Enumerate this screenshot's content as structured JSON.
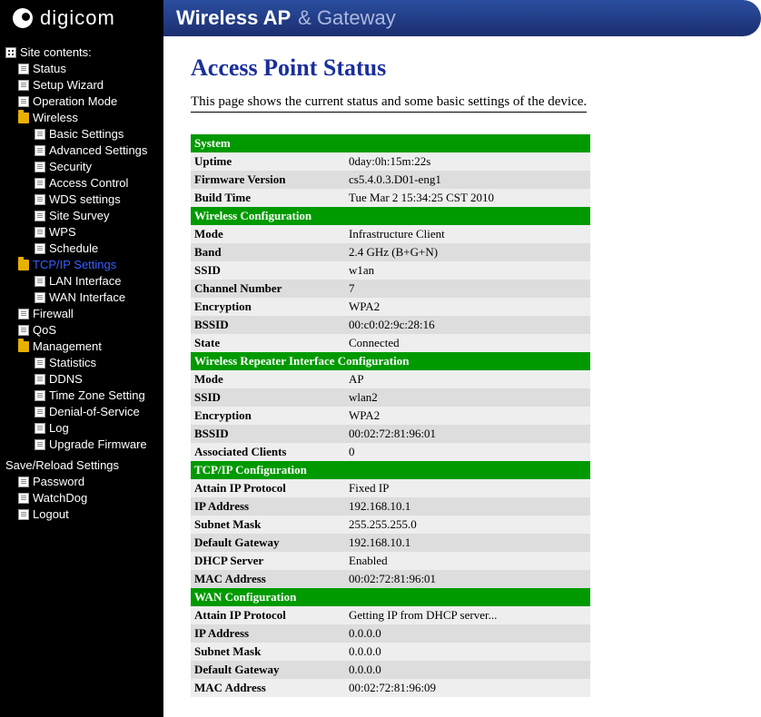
{
  "header": {
    "brand": "digicom",
    "title_strong": "Wireless AP",
    "title_sub": "& Gateway"
  },
  "sidebar": {
    "root_label": "Site contents:",
    "items": [
      {
        "label": "Status",
        "level": 1,
        "icon": "page",
        "selected": false
      },
      {
        "label": "Setup Wizard",
        "level": 1,
        "icon": "page",
        "selected": false
      },
      {
        "label": "Operation Mode",
        "level": 1,
        "icon": "page",
        "selected": false
      },
      {
        "label": "Wireless",
        "level": 1,
        "icon": "folder",
        "selected": false
      },
      {
        "label": "Basic Settings",
        "level": 2,
        "icon": "page",
        "selected": false
      },
      {
        "label": "Advanced Settings",
        "level": 2,
        "icon": "page",
        "selected": false
      },
      {
        "label": "Security",
        "level": 2,
        "icon": "page",
        "selected": false
      },
      {
        "label": "Access Control",
        "level": 2,
        "icon": "page",
        "selected": false
      },
      {
        "label": "WDS settings",
        "level": 2,
        "icon": "page",
        "selected": false
      },
      {
        "label": "Site Survey",
        "level": 2,
        "icon": "page",
        "selected": false
      },
      {
        "label": "WPS",
        "level": 2,
        "icon": "page",
        "selected": false
      },
      {
        "label": "Schedule",
        "level": 2,
        "icon": "page",
        "selected": false
      },
      {
        "label": "TCP/IP Settings",
        "level": 1,
        "icon": "folder",
        "selected": true
      },
      {
        "label": "LAN Interface",
        "level": 2,
        "icon": "page",
        "selected": false
      },
      {
        "label": "WAN Interface",
        "level": 2,
        "icon": "page",
        "selected": false
      },
      {
        "label": "Firewall",
        "level": 1,
        "icon": "page",
        "selected": false
      },
      {
        "label": "QoS",
        "level": 1,
        "icon": "page",
        "selected": false
      },
      {
        "label": "Management",
        "level": 1,
        "icon": "folder",
        "selected": false
      },
      {
        "label": "Statistics",
        "level": 2,
        "icon": "page",
        "selected": false
      },
      {
        "label": "DDNS",
        "level": 2,
        "icon": "page",
        "selected": false
      },
      {
        "label": "Time Zone Setting",
        "level": 2,
        "icon": "page",
        "selected": false
      },
      {
        "label": "Denial-of-Service",
        "level": 2,
        "icon": "page",
        "selected": false
      },
      {
        "label": "Log",
        "level": 2,
        "icon": "page",
        "selected": false
      },
      {
        "label": "Upgrade Firmware",
        "level": 2,
        "icon": "page",
        "selected": false
      }
    ],
    "root2_label": "Save/Reload Settings",
    "items2": [
      {
        "label": "Password",
        "level": 1,
        "icon": "page",
        "selected": false
      },
      {
        "label": "WatchDog",
        "level": 1,
        "icon": "page",
        "selected": false
      },
      {
        "label": "Logout",
        "level": 1,
        "icon": "page",
        "selected": false
      }
    ]
  },
  "page": {
    "title": "Access Point Status",
    "description": "This page shows the current status and some basic settings of the device.",
    "sections": [
      {
        "header": "System",
        "rows": [
          {
            "key": "Uptime",
            "value": "0day:0h:15m:22s"
          },
          {
            "key": "Firmware Version",
            "value": "cs5.4.0.3.D01-eng1"
          },
          {
            "key": "Build Time",
            "value": "Tue Mar 2 15:34:25 CST 2010"
          }
        ]
      },
      {
        "header": "Wireless Configuration",
        "rows": [
          {
            "key": "Mode",
            "value": "Infrastructure Client"
          },
          {
            "key": "Band",
            "value": "2.4 GHz (B+G+N)"
          },
          {
            "key": "SSID",
            "value": "w1an"
          },
          {
            "key": "Channel Number",
            "value": "7"
          },
          {
            "key": "Encryption",
            "value": "WPA2"
          },
          {
            "key": "BSSID",
            "value": "00:c0:02:9c:28:16"
          },
          {
            "key": "State",
            "value": "Connected"
          }
        ]
      },
      {
        "header": "Wireless Repeater Interface Configuration",
        "rows": [
          {
            "key": "Mode",
            "value": "AP"
          },
          {
            "key": "SSID",
            "value": "wlan2"
          },
          {
            "key": "Encryption",
            "value": "WPA2"
          },
          {
            "key": "BSSID",
            "value": "00:02:72:81:96:01"
          },
          {
            "key": "Associated Clients",
            "value": "0"
          }
        ]
      },
      {
        "header": "TCP/IP Configuration",
        "rows": [
          {
            "key": "Attain IP Protocol",
            "value": "Fixed IP"
          },
          {
            "key": "IP Address",
            "value": "192.168.10.1"
          },
          {
            "key": "Subnet Mask",
            "value": "255.255.255.0"
          },
          {
            "key": "Default Gateway",
            "value": "192.168.10.1"
          },
          {
            "key": "DHCP Server",
            "value": "Enabled"
          },
          {
            "key": "MAC Address",
            "value": "00:02:72:81:96:01"
          }
        ]
      },
      {
        "header": "WAN Configuration",
        "rows": [
          {
            "key": "Attain IP Protocol",
            "value": "Getting IP from DHCP server..."
          },
          {
            "key": "IP Address",
            "value": "0.0.0.0"
          },
          {
            "key": "Subnet Mask",
            "value": "0.0.0.0"
          },
          {
            "key": "Default Gateway",
            "value": "0.0.0.0"
          },
          {
            "key": "MAC Address",
            "value": "00:02:72:81:96:09"
          }
        ]
      }
    ]
  }
}
